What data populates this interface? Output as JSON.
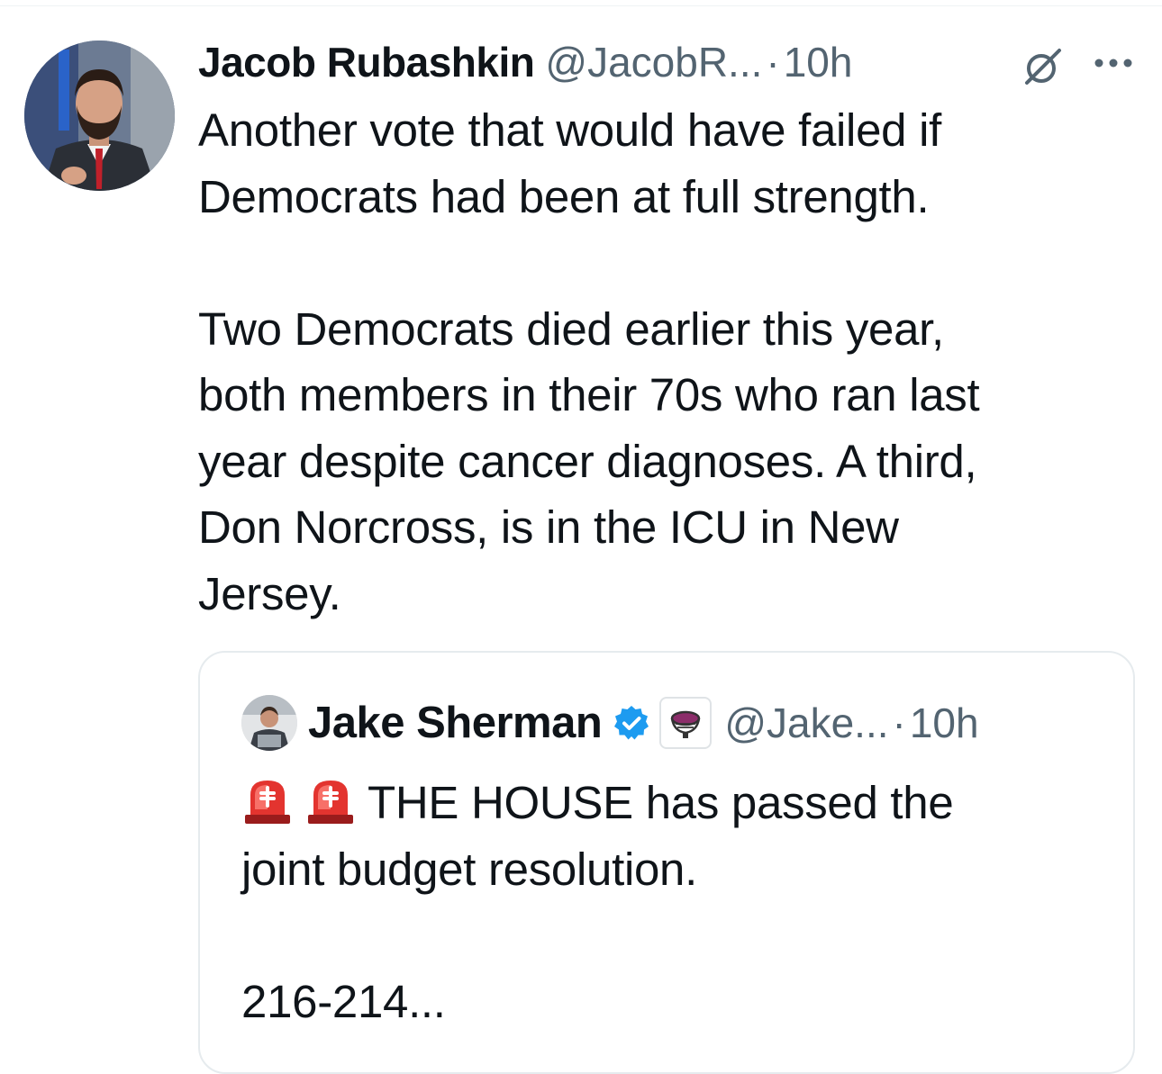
{
  "tweet": {
    "author_name": "Jacob Rubashkin",
    "handle": "@JacobR...",
    "separator": "·",
    "time": "10h",
    "text": "Another vote that would have failed if\nDemocrats had been at full strength.\n\nTwo Democrats died earlier this year,\nboth members in their 70s who ran last\nyear despite cancer diagnoses. A third,\nDon Norcross, is in the ICU in New\nJersey.",
    "icons": [
      "avatar",
      "grok-icon",
      "more-icon"
    ]
  },
  "quoted_tweet": {
    "author_name": "Jake Sherman",
    "handle": "@Jake...",
    "separator": "·",
    "time": "10h",
    "text_line1": "THE HOUSE has passed the",
    "text_rest": "joint budget resolution.\n\n216-214...",
    "icons": [
      "avatar",
      "verified-badge-icon",
      "affiliate-badge-icon",
      "siren-emoji-icon",
      "siren-emoji-icon"
    ]
  },
  "colors": {
    "text_primary": "#0f1419",
    "text_secondary": "#536471",
    "verified_blue": "#1d9bf0",
    "border": "#e6ebee"
  }
}
